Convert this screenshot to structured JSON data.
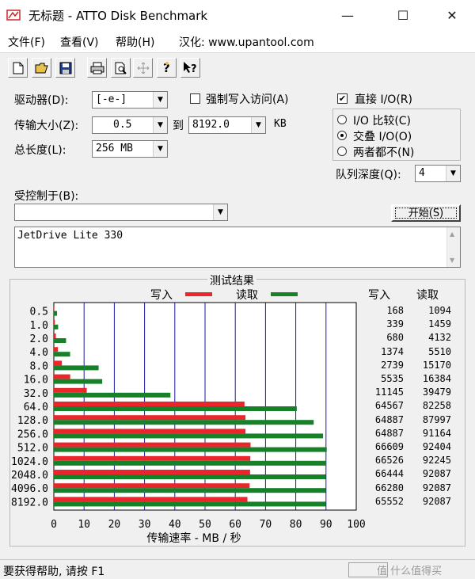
{
  "window": {
    "title": "无标题 - ATTO Disk Benchmark",
    "buttons": {
      "minimize": "—",
      "maximize": "☐",
      "close": "✕"
    }
  },
  "menu": [
    {
      "label": "文件(F)"
    },
    {
      "label": "查看(V)"
    },
    {
      "label": "帮助(H)"
    },
    {
      "label": "汉化: www.upantool.com"
    }
  ],
  "toolbar": [
    {
      "name": "new-file-icon",
      "glyph": "🗋"
    },
    {
      "name": "open-folder-icon",
      "glyph": "📂"
    },
    {
      "name": "save-icon",
      "glyph": "💾"
    },
    {
      "name": "print-icon",
      "glyph": "🖶"
    },
    {
      "name": "print-preview-icon",
      "glyph": "🔍"
    },
    {
      "name": "move-icon",
      "glyph": "✥"
    },
    {
      "name": "help-icon",
      "glyph": "?"
    },
    {
      "name": "context-help-icon",
      "glyph": "↖?"
    }
  ],
  "settings": {
    "drive_label": "驱动器(D):",
    "drive_value": "[-e-]",
    "transfer_size_label": "传输大小(Z):",
    "transfer_from": "0.5",
    "to_label": "到",
    "transfer_to": "8192.0",
    "unit_kb": "KB",
    "total_length_label": "总长度(L):",
    "total_length_value": "256 MB",
    "force_write_label": "强制写入访问(A)",
    "force_write_checked": false,
    "direct_io_label": "直接 I/O(R)",
    "direct_io_checked": true,
    "radio_compare": "I/O 比较(C)",
    "radio_overlap": "交叠 I/O(O)",
    "radio_neither": "两者都不(N)",
    "selected_mode": "overlap",
    "queue_depth_label": "队列深度(Q):",
    "queue_depth_value": "4",
    "controlled_by_label": "受控制于(B):",
    "controlled_by_value": "",
    "start_button": "开始(S)",
    "description": "JetDrive Lite 330"
  },
  "results": {
    "group_title": "测试结果",
    "legend_write": "写入",
    "legend_read": "读取",
    "col_write": "写入",
    "col_read": "读取",
    "colors": {
      "write": "#e8262b",
      "read": "#17812a",
      "grid": "#1a1aa0"
    },
    "rows": [
      {
        "size": "0.5",
        "write": "168",
        "read": "1094"
      },
      {
        "size": "1.0",
        "write": "339",
        "read": "1459"
      },
      {
        "size": "2.0",
        "write": "680",
        "read": "4132"
      },
      {
        "size": "4.0",
        "write": "1374",
        "read": "5510"
      },
      {
        "size": "8.0",
        "write": "2739",
        "read": "15170"
      },
      {
        "size": "16.0",
        "write": "5535",
        "read": "16384"
      },
      {
        "size": "32.0",
        "write": "11145",
        "read": "39479"
      },
      {
        "size": "64.0",
        "write": "64567",
        "read": "82258"
      },
      {
        "size": "128.0",
        "write": "64887",
        "read": "87997"
      },
      {
        "size": "256.0",
        "write": "64887",
        "read": "91164"
      },
      {
        "size": "512.0",
        "write": "66609",
        "read": "92404"
      },
      {
        "size": "1024.0",
        "write": "66526",
        "read": "92245"
      },
      {
        "size": "2048.0",
        "write": "66444",
        "read": "92087"
      },
      {
        "size": "4096.0",
        "write": "66280",
        "read": "92087"
      },
      {
        "size": "8192.0",
        "write": "65552",
        "read": "92087"
      }
    ]
  },
  "chart_data": {
    "type": "bar",
    "categories": [
      "0.5",
      "1.0",
      "2.0",
      "4.0",
      "8.0",
      "16.0",
      "32.0",
      "64.0",
      "128.0",
      "256.0",
      "512.0",
      "1024.0",
      "2048.0",
      "4096.0",
      "8192.0"
    ],
    "series": [
      {
        "name": "写入",
        "values": [
          0.16,
          0.33,
          0.66,
          1.34,
          2.67,
          5.41,
          10.88,
          63.05,
          63.37,
          63.37,
          65.05,
          64.97,
          64.89,
          64.73,
          64.02
        ]
      },
      {
        "name": "读取",
        "values": [
          1.07,
          1.42,
          4.04,
          5.38,
          14.81,
          16.0,
          38.55,
          80.33,
          85.93,
          89.03,
          90.24,
          90.08,
          89.93,
          89.93,
          89.93
        ]
      }
    ],
    "xlabel": "传输速率 - MB / 秒",
    "ylabel": "",
    "xlim": [
      0,
      100
    ],
    "xticks": [
      "0",
      "10",
      "20",
      "30",
      "40",
      "50",
      "60",
      "70",
      "80",
      "90",
      "100"
    ],
    "orientation": "horizontal",
    "grid": true
  },
  "status": {
    "text": "要获得帮助, 请按 F1",
    "watermark": "值 什么值得买"
  }
}
